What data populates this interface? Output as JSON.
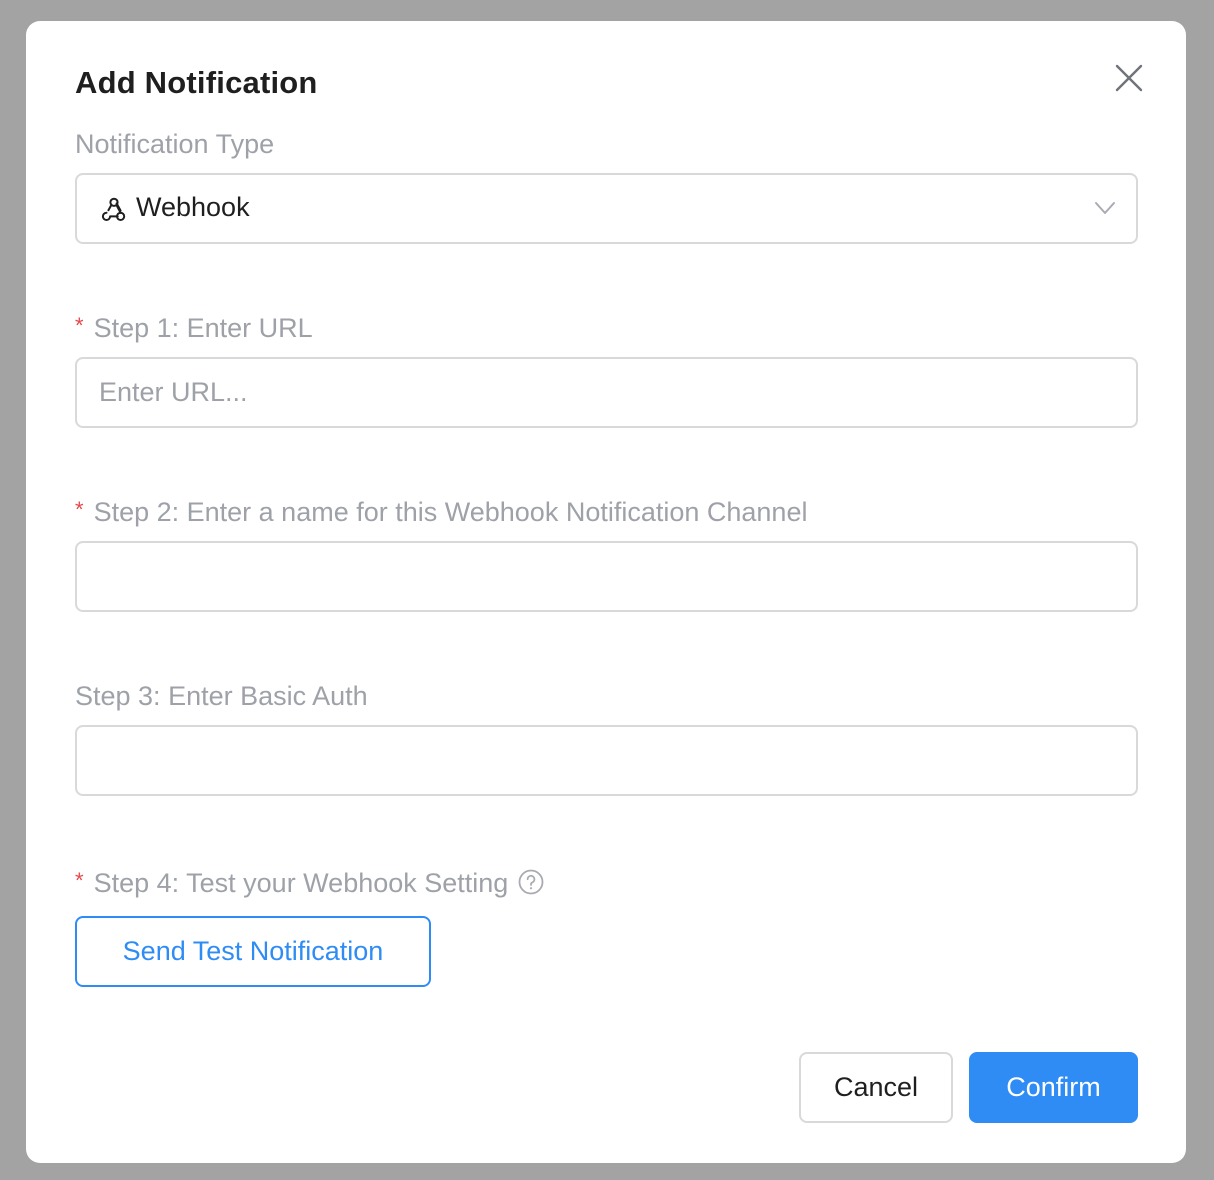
{
  "dialog": {
    "title": "Add Notification"
  },
  "notification_type": {
    "label": "Notification Type",
    "selected": "Webhook",
    "icon": "webhook-icon"
  },
  "step1": {
    "required_mark": "*",
    "label": "Step 1: Enter URL",
    "placeholder": "Enter URL...",
    "value": ""
  },
  "step2": {
    "required_mark": "*",
    "label": "Step 2: Enter a name for this Webhook Notification Channel",
    "placeholder": "",
    "value": ""
  },
  "step3": {
    "label": "Step 3: Enter Basic Auth",
    "placeholder": "",
    "value": ""
  },
  "step4": {
    "required_mark": "*",
    "label": "Step 4: Test your Webhook Setting",
    "button_label": "Send Test Notification"
  },
  "footer": {
    "cancel_label": "Cancel",
    "confirm_label": "Confirm"
  },
  "colors": {
    "primary": "#2f8cf4",
    "required": "#e5484d",
    "label": "#9ea2a8",
    "border": "#d9d9d9",
    "overlay": "#a3a3a3"
  }
}
